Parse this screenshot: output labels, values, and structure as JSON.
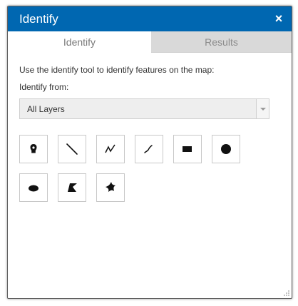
{
  "window": {
    "title": "Identify",
    "close_glyph": "×"
  },
  "tabs": [
    {
      "label": "Identify",
      "active": true
    },
    {
      "label": "Results",
      "active": false
    }
  ],
  "identify": {
    "description": "Use the identify tool to identify features on the map:",
    "from_label": "Identify from:",
    "layer_select": {
      "selected": "All Layers"
    }
  },
  "tools": [
    {
      "name": "point",
      "icon": "point-marker-icon"
    },
    {
      "name": "line",
      "icon": "line-icon"
    },
    {
      "name": "polyline",
      "icon": "polyline-icon"
    },
    {
      "name": "freehand-polyline",
      "icon": "freehand-line-icon"
    },
    {
      "name": "extent",
      "icon": "rectangle-icon"
    },
    {
      "name": "circle",
      "icon": "circle-icon"
    },
    {
      "name": "ellipse",
      "icon": "ellipse-icon"
    },
    {
      "name": "polygon",
      "icon": "polygon-icon"
    },
    {
      "name": "freehand-polygon",
      "icon": "freehand-polygon-icon"
    }
  ],
  "colors": {
    "title_bar": "#0067b1",
    "title_text": "#ffffff",
    "inactive_tab": "#d9d9d9",
    "tab_text": "#7a7a7a",
    "icon": "#111111"
  }
}
